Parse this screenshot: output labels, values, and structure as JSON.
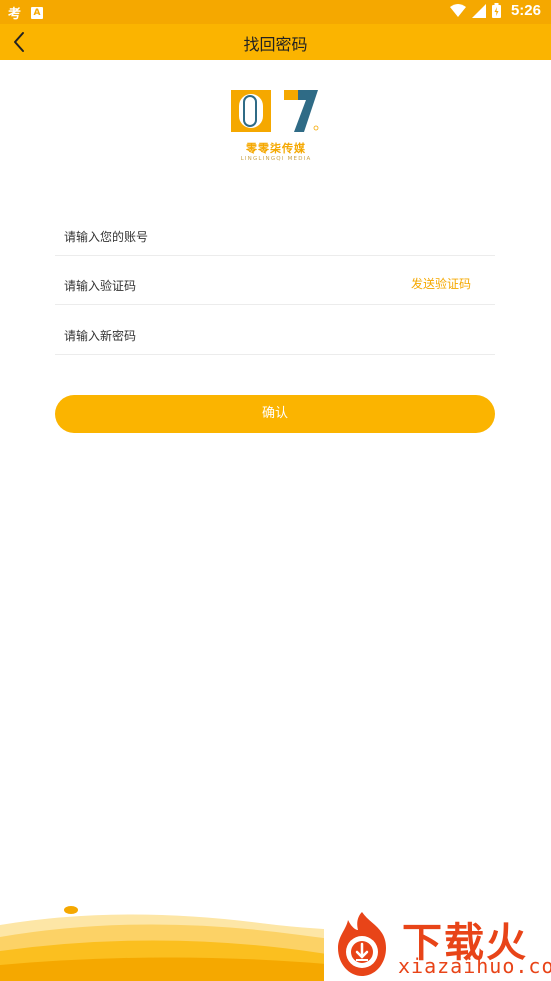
{
  "status_bar": {
    "app_icon_text": "考",
    "badge_letter": "A",
    "time": "5:26"
  },
  "toolbar": {
    "title": "找回密码"
  },
  "logo": {
    "brand_cn": "零零柒传媒",
    "brand_en": "LINGLINGQI MEDIA",
    "brand_color": "#f5a800"
  },
  "form": {
    "account_placeholder": "请输入您的账号",
    "code_placeholder": "请输入验证码",
    "send_code_label": "发送验证码",
    "password_placeholder": "请输入新密码",
    "confirm_label": "确认"
  },
  "watermark": {
    "title": "下载火",
    "url": "xiazaihuo.com"
  },
  "colors": {
    "accent": "#fbb400",
    "status_bar": "#f5a800",
    "watermark": "#e84418"
  }
}
